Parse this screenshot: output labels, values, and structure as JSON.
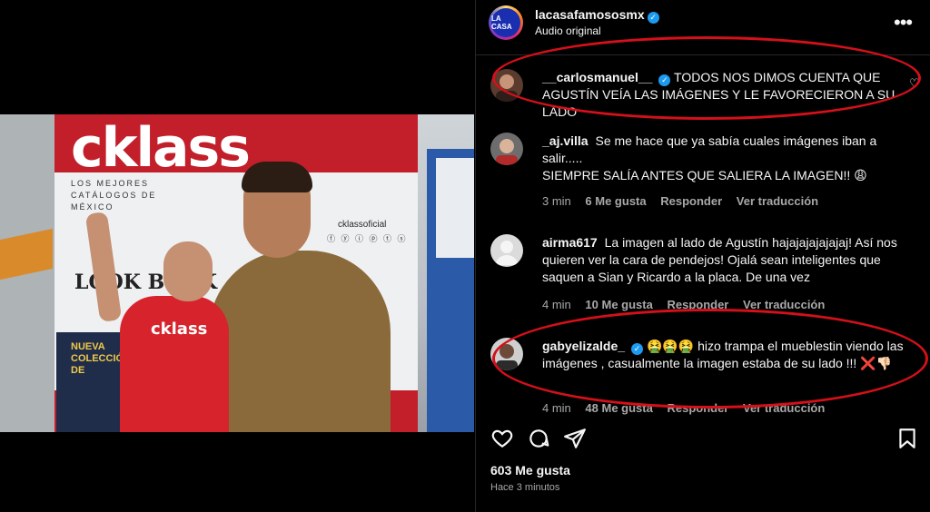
{
  "video": {
    "brand": "cklass",
    "catalog_lines": "LOS MEJORES CATÁLOGOS DE MÉXICO",
    "handle": "cklassoficial",
    "social": "ⓕ ⓨ ⓘ ⓟ ⓣ ⓢ",
    "look": "LOOK BOOK",
    "nueva": "NUEVA COLECCIÓN DE",
    "shirt": "cklass",
    "mute_icon": "speaker-muted-icon"
  },
  "header": {
    "avatar_text": "LA CASA",
    "username": "lacasafamososmx",
    "subtitle": "Audio original",
    "more": "•••"
  },
  "comments": [
    {
      "username": "__carlosmanuel__",
      "verified": true,
      "text": "TODOS NOS DIMOS CUENTA QUE AGUSTÍN VEÍA LAS IMÁGENES Y LE FAVORECIERON A SU LADO"
    },
    {
      "username": "_aj.villa",
      "verified": false,
      "text": "Se me hace que ya sabía cuales imágenes iban a salir.....",
      "text2": "SIEMPRE SALÍA ANTES QUE SALIERA LA IMAGEN!! 😩",
      "time": "3 min",
      "likes": "6 Me gusta",
      "reply": "Responder",
      "translate": "Ver traducción"
    },
    {
      "username": "airma617",
      "verified": false,
      "text": "La imagen al lado de Agustín hajajajajajajaj! Así nos quieren ver la cara de pendejos! Ojalá sean inteligentes que saquen a Sian y Ricardo a la placa. De una vez",
      "time": "4 min",
      "likes": "10 Me gusta",
      "reply": "Responder",
      "translate": "Ver traducción"
    },
    {
      "username": "gabyelizalde_",
      "verified": true,
      "text": "🤮🤮🤮 hizo trampa el mueblestin viendo las imágenes , casualmente la imagen estaba de su lado !!! ❌👎🏻",
      "time": "4 min",
      "likes": "48 Me gusta",
      "reply": "Responder",
      "translate": "Ver traducción"
    }
  ],
  "footer": {
    "likes": "603 Me gusta",
    "time_ago": "Hace 3 minutos"
  },
  "colors": {
    "background": "#000000",
    "text": "#f5f5f5",
    "muted": "#a8a8a8",
    "verified": "#1d9bf0",
    "annotation_ring": "#d4101a",
    "brand_red": "#c21f2b"
  }
}
